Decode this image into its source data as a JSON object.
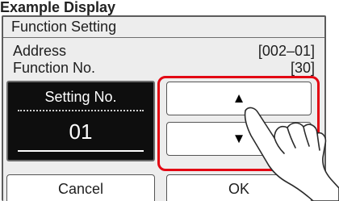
{
  "caption": "Example Display",
  "screen": {
    "title": "Function Setting",
    "address_label": "Address",
    "address_value": "[002–01]",
    "function_label": "Function No.",
    "function_value": "[30]",
    "setting_label": "Setting No.",
    "setting_value": "01",
    "up_arrow": "▲",
    "down_arrow": "▼",
    "cancel_label": "Cancel",
    "ok_label": "OK"
  },
  "colors": {
    "highlight": "#e30613",
    "panel_dark": "#0e0e0e",
    "background": "#ededed"
  },
  "icons": {
    "hand": "pointing-hand-icon"
  }
}
